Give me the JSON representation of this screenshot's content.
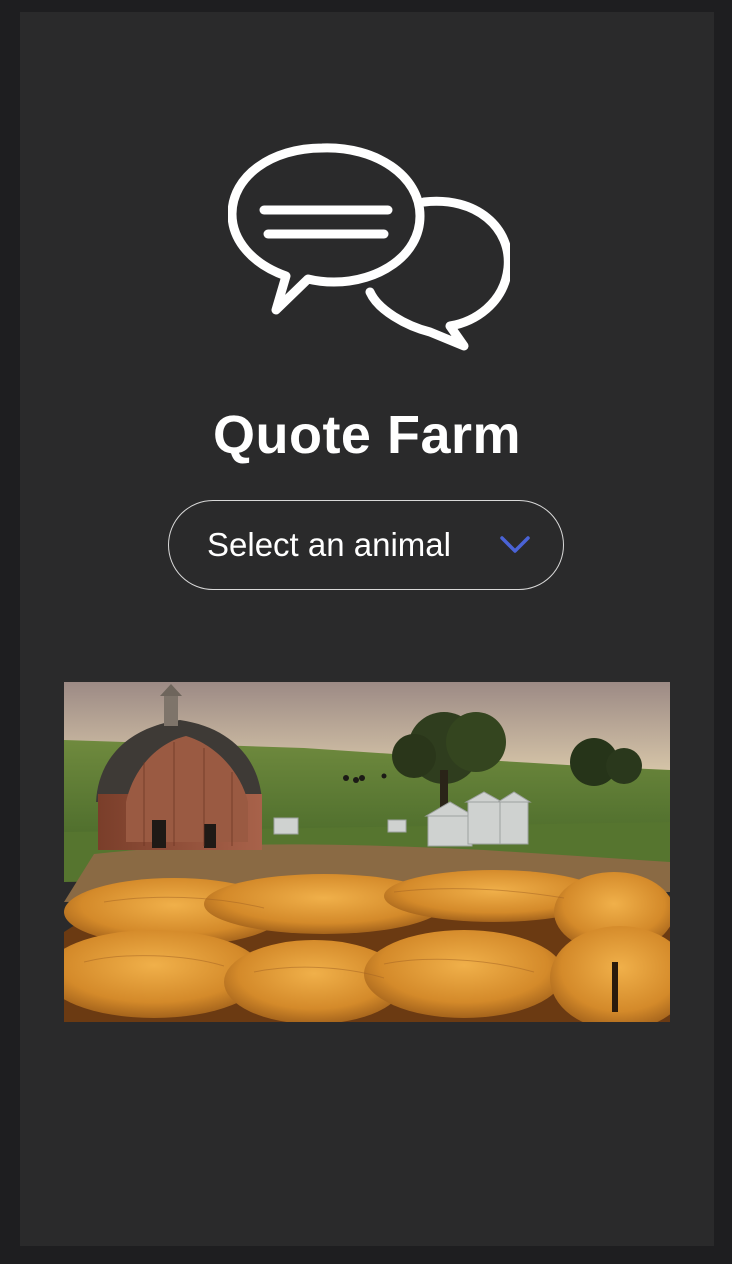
{
  "app": {
    "title": "Quote Farm"
  },
  "animal_select": {
    "placeholder": "Select an animal"
  },
  "icons": {
    "logo": "speech-bubbles-icon",
    "dropdown": "chevron-down-icon"
  },
  "colors": {
    "background": "#2a2a2b",
    "text": "#ffffff",
    "accent": "#4a63d6"
  },
  "images": {
    "hero": "farm-scene-barn-silos-hay-bales"
  }
}
